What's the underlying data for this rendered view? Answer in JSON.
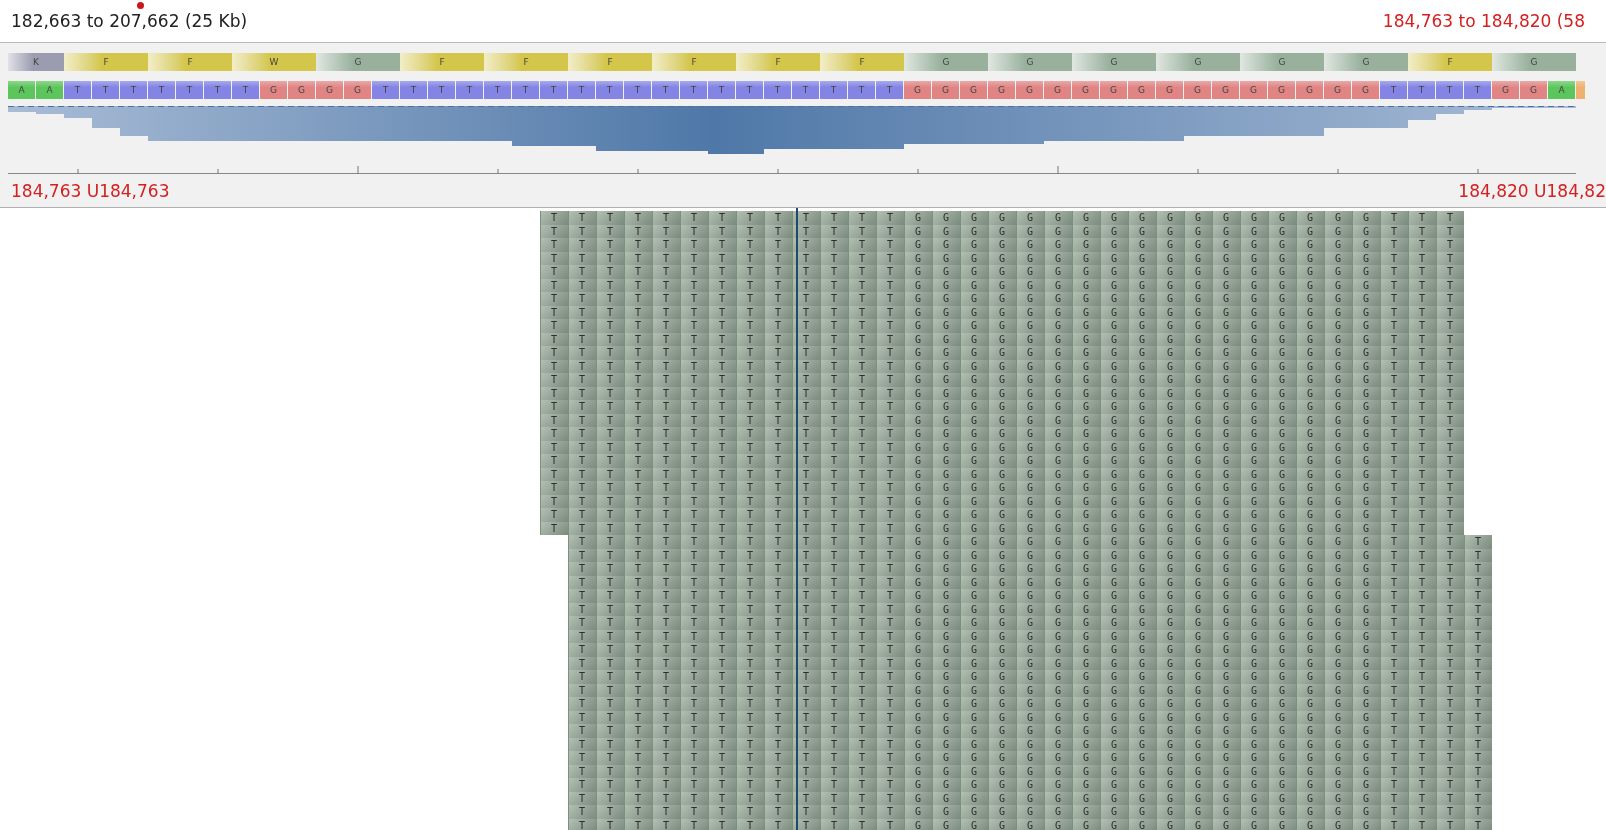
{
  "header": {
    "range": "182,663 to 207,662 (25 Kb)",
    "view_range": "184,763 to 184,820 (58"
  },
  "translation": [
    {
      "letter": "K",
      "color": "#9c9cb0",
      "partial": true
    },
    {
      "letter": "F",
      "color": "#d4c64a",
      "partial": false
    },
    {
      "letter": "F",
      "color": "#d4c64a",
      "partial": false
    },
    {
      "letter": "W",
      "color": "#d4c64a",
      "partial": false
    },
    {
      "letter": "G",
      "color": "#98b09c",
      "partial": false
    },
    {
      "letter": "F",
      "color": "#d4c64a",
      "partial": false
    },
    {
      "letter": "F",
      "color": "#d4c64a",
      "partial": false
    },
    {
      "letter": "F",
      "color": "#d4c64a",
      "partial": false
    },
    {
      "letter": "F",
      "color": "#d4c64a",
      "partial": false
    },
    {
      "letter": "F",
      "color": "#d4c64a",
      "partial": false
    },
    {
      "letter": "F",
      "color": "#d4c64a",
      "partial": false
    },
    {
      "letter": "G",
      "color": "#98b09c",
      "partial": false
    },
    {
      "letter": "G",
      "color": "#98b09c",
      "partial": false
    },
    {
      "letter": "G",
      "color": "#98b09c",
      "partial": false
    },
    {
      "letter": "G",
      "color": "#98b09c",
      "partial": false
    },
    {
      "letter": "G",
      "color": "#98b09c",
      "partial": false
    },
    {
      "letter": "G",
      "color": "#98b09c",
      "partial": false
    },
    {
      "letter": "F",
      "color": "#d4c64a",
      "partial": false
    },
    {
      "letter": "G",
      "color": "#98b09c",
      "partial": false
    }
  ],
  "reference": {
    "bases": [
      {
        "base": "A",
        "color": "#5cc65c"
      },
      {
        "base": "A",
        "color": "#5cc65c"
      },
      {
        "base": "T",
        "color": "#8484e4"
      },
      {
        "base": "T",
        "color": "#8484e4"
      },
      {
        "base": "T",
        "color": "#8484e4"
      },
      {
        "base": "T",
        "color": "#8484e4"
      },
      {
        "base": "T",
        "color": "#8484e4"
      },
      {
        "base": "T",
        "color": "#8484e4"
      },
      {
        "base": "T",
        "color": "#8484e4"
      },
      {
        "base": "G",
        "color": "#e08484"
      },
      {
        "base": "G",
        "color": "#e08484"
      },
      {
        "base": "G",
        "color": "#e08484"
      },
      {
        "base": "G",
        "color": "#e08484"
      },
      {
        "base": "T",
        "color": "#8484e4"
      },
      {
        "base": "T",
        "color": "#8484e4"
      },
      {
        "base": "T",
        "color": "#8484e4"
      },
      {
        "base": "T",
        "color": "#8484e4"
      },
      {
        "base": "T",
        "color": "#8484e4"
      },
      {
        "base": "T",
        "color": "#8484e4"
      },
      {
        "base": "T",
        "color": "#8484e4"
      },
      {
        "base": "T",
        "color": "#8484e4"
      },
      {
        "base": "T",
        "color": "#8484e4"
      },
      {
        "base": "T",
        "color": "#8484e4"
      },
      {
        "base": "T",
        "color": "#8484e4"
      },
      {
        "base": "T",
        "color": "#8484e4"
      },
      {
        "base": "T",
        "color": "#8484e4"
      },
      {
        "base": "T",
        "color": "#8484e4"
      },
      {
        "base": "T",
        "color": "#8484e4"
      },
      {
        "base": "T",
        "color": "#8484e4"
      },
      {
        "base": "T",
        "color": "#8484e4"
      },
      {
        "base": "T",
        "color": "#8484e4"
      },
      {
        "base": "T",
        "color": "#8484e4"
      },
      {
        "base": "G",
        "color": "#e08484"
      },
      {
        "base": "G",
        "color": "#e08484"
      },
      {
        "base": "G",
        "color": "#e08484"
      },
      {
        "base": "G",
        "color": "#e08484"
      },
      {
        "base": "G",
        "color": "#e08484"
      },
      {
        "base": "G",
        "color": "#e08484"
      },
      {
        "base": "G",
        "color": "#e08484"
      },
      {
        "base": "G",
        "color": "#e08484"
      },
      {
        "base": "G",
        "color": "#e08484"
      },
      {
        "base": "G",
        "color": "#e08484"
      },
      {
        "base": "G",
        "color": "#e08484"
      },
      {
        "base": "G",
        "color": "#e08484"
      },
      {
        "base": "G",
        "color": "#e08484"
      },
      {
        "base": "G",
        "color": "#e08484"
      },
      {
        "base": "G",
        "color": "#e08484"
      },
      {
        "base": "G",
        "color": "#e08484"
      },
      {
        "base": "G",
        "color": "#e08484"
      },
      {
        "base": "T",
        "color": "#8484e4"
      },
      {
        "base": "T",
        "color": "#8484e4"
      },
      {
        "base": "T",
        "color": "#8484e4"
      },
      {
        "base": "T",
        "color": "#8484e4"
      },
      {
        "base": "G",
        "color": "#e08484"
      },
      {
        "base": "G",
        "color": "#e08484"
      },
      {
        "base": "A",
        "color": "#5cc65c"
      },
      {
        "color": "#f0b070"
      }
    ]
  },
  "ruler": {
    "left_label": "184,763 U184,763",
    "right_label": "184,820 U184,82"
  },
  "reads": [
    "                   TTTTTTTTTTTTTGGGGGGGGGGGGGGGGGTTT",
    "                   TTTTTTTTTTTTTGGGGGGGGGGGGGGGGGTTT",
    "                   TTTTTTTTTTTTTGGGGGGGGGGGGGGGGGTTT",
    "                   TTTTTTTTTTTTTGGGGGGGGGGGGGGGGGTTT",
    "                   TTTTTTTTTTTTTGGGGGGGGGGGGGGGGGTTT",
    "                   TTTTTTTTTTTTTGGGGGGGGGGGGGGGGGTTT",
    "                   TTTTTTTTTTTTTGGGGGGGGGGGGGGGGGTTT",
    "                   TTTTTTTTTTTTTGGGGGGGGGGGGGGGGGTTT",
    "                   TTTTTTTTTTTTTGGGGGGGGGGGGGGGGGTTT",
    "                   TTTTTTTTTTTTTGGGGGGGGGGGGGGGGGTTT",
    "                   TTTTTTTTTTTTTGGGGGGGGGGGGGGGGGTTT",
    "                   TTTTTTTTTTTTTGGGGGGGGGGGGGGGGGTTT",
    "                   TTTTTTTTTTTTTGGGGGGGGGGGGGGGGGTTT",
    "                   TTTTTTTTTTTTTGGGGGGGGGGGGGGGGGTTT",
    "                   TTTTTTTTTTTTTGGGGGGGGGGGGGGGGGTTT",
    "                   TTTTTTTTTTTTTGGGGGGGGGGGGGGGGGTTT",
    "                   TTTTTTTTTTTTTGGGGGGGGGGGGGGGGGTTT",
    "                   TTTTTTTTTTTTTGGGGGGGGGGGGGGGGGTTT",
    "                   TTTTTTTTTTTTTGGGGGGGGGGGGGGGGGTTT",
    "                   TTTTTTTTTTTTTGGGGGGGGGGGGGGGGGTTT",
    "                   TTTTTTTTTTTTTGGGGGGGGGGGGGGGGGTTT",
    "                   TTTTTTTTTTTTTGGGGGGGGGGGGGGGGGTTT",
    "                   TTTTTTTTTTTTTGGGGGGGGGGGGGGGGGTTT",
    "                   TTTTTTTTTTTTTGGGGGGGGGGGGGGGGGTTT",
    "                    TTTTTTTTTTTTGGGGGGGGGGGGGGGGGTTTT",
    "                    TTTTTTTTTTTTGGGGGGGGGGGGGGGGGTTTT",
    "                    TTTTTTTTTTTTGGGGGGGGGGGGGGGGGTTTT",
    "                    TTTTTTTTTTTTGGGGGGGGGGGGGGGGGTTTT",
    "                    TTTTTTTTTTTTGGGGGGGGGGGGGGGGGTTTT",
    "                    TTTTTTTTTTTTGGGGGGGGGGGGGGGGGTTTT",
    "                    TTTTTTTTTTTTGGGGGGGGGGGGGGGGGTTTT",
    "                    TTTTTTTTTTTTGGGGGGGGGGGGGGGGGTTTT",
    "                    TTTTTTTTTTTTGGGGGGGGGGGGGGGGGTTTT",
    "                    TTTTTTTTTTTTGGGGGGGGGGGGGGGGGTTTT",
    "                    TTTTTTTTTTTTGGGGGGGGGGGGGGGGGTTTT",
    "                    TTTTTTTTTTTTGGGGGGGGGGGGGGGGGTTTT",
    "                    TTTTTTTTTTTTGGGGGGGGGGGGGGGGGTTTT",
    "                    TTTTTTTTTTTTGGGGGGGGGGGGGGGGGTTTT",
    "                    TTTTTTTTTTTTGGGGGGGGGGGGGGGGGTTTT",
    "                    TTTTTTTTTTTTGGGGGGGGGGGGGGGGGTTTT",
    "                    TTTTTTTTTTTTGGGGGGGGGGGGGGGGGTTTT",
    "                    TTTTTTTTTTTTGGGGGGGGGGGGGGGGGTTTT",
    "                    TTTTTTTTTTTTGGGGGGGGGGGGGGGGGTTTT",
    "                    TTTTTTTTTTTTGGGGGGGGGGGGGGGGGTTTT",
    "                    TTTTTTTTTTTTGGGGGGGGGGGGGGGGGTTTT",
    "                    TTTTTTTTTTTTGGGGGGGGGGGGGGGGGTTTT"
  ]
}
